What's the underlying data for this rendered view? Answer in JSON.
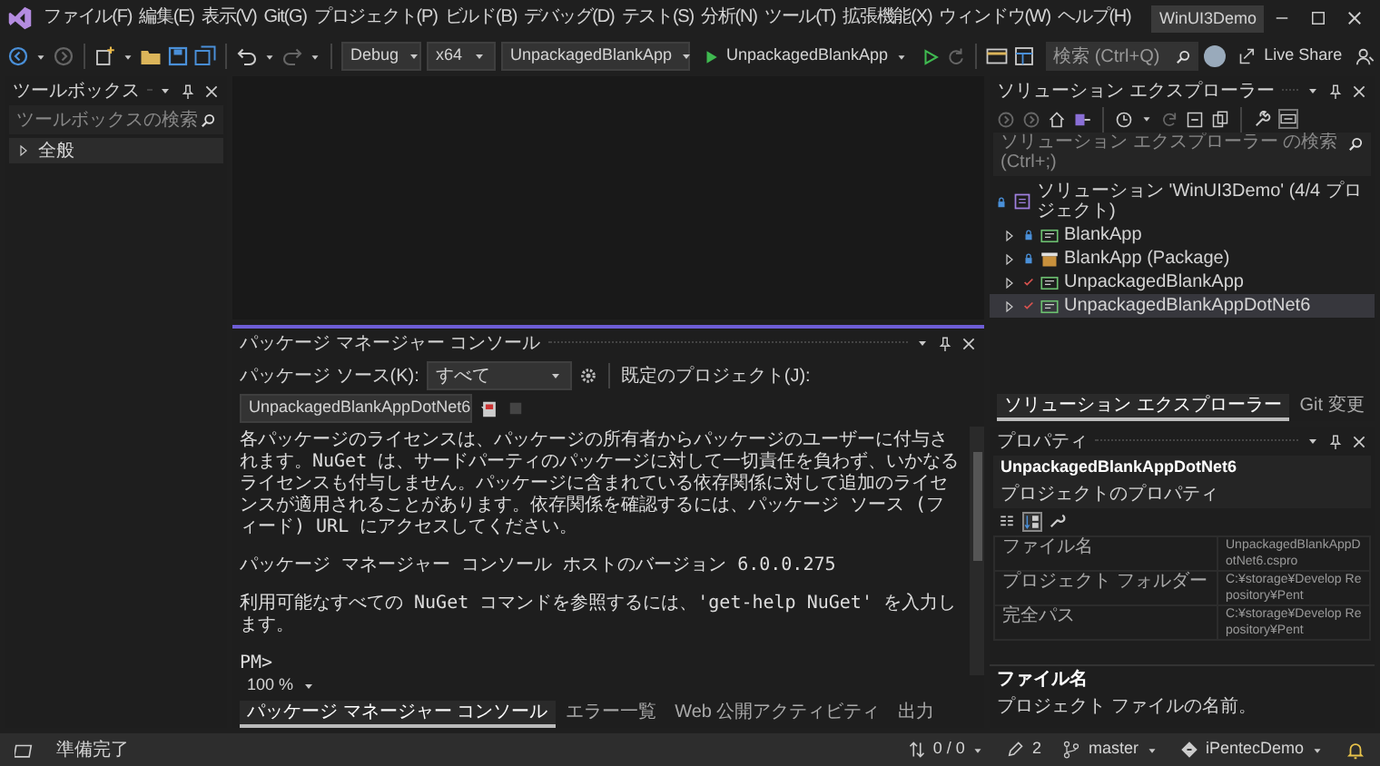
{
  "title_bar": {
    "menu": [
      "ファイル(F)",
      "編集(E)",
      "表示(V)",
      "Git(G)",
      "プロジェクト(P)",
      "ビルド(B)",
      "デバッグ(D)",
      "テスト(S)",
      "分析(N)",
      "ツール(T)",
      "拡張機能(X)",
      "ウィンドウ(W)",
      "ヘルプ(H)"
    ],
    "search": {
      "placeholder": "検索 (Ctrl+Q)"
    },
    "solution_name": "WinUI3Demo"
  },
  "toolbar": {
    "configuration": "Debug",
    "platform": "x64",
    "startup_project": "UnpackagedBlankApp",
    "run_label": "UnpackagedBlankApp",
    "live_share": "Live Share"
  },
  "toolbox": {
    "title": "ツールボックス",
    "search": {
      "placeholder": "ツールボックスの検索"
    },
    "items": [
      {
        "label": "全般",
        "expanded": false
      }
    ]
  },
  "console": {
    "title": "パッケージ マネージャー コンソール",
    "source_label": "パッケージ ソース(K):",
    "source": "すべて",
    "project_label": "既定のプロジェクト(J):",
    "project": "UnpackagedBlankAppDotNet6",
    "lines": [
      "各パッケージのライセンスは、パッケージの所有者からパッケージのユーザーに付与されます。NuGet は、サードパーティのパッケージに対して一切責任を負わず、いかなるライセンスも付与しません。パッケージに含まれている依存関係に対して追加のライセンスが適用されることがあります。依存関係を確認するには、パッケージ ソース (フィード) URL にアクセスしてください。",
      "パッケージ マネージャー コンソール ホストのバージョン 6.0.0.275",
      "利用可能なすべての NuGet コマンドを参照するには、'get-help NuGet' を入力します。",
      "PM>"
    ],
    "zoom": "100 %",
    "tabs": [
      {
        "label": "パッケージ マネージャー コンソール",
        "selected": true
      },
      {
        "label": "エラー一覧",
        "selected": false
      },
      {
        "label": "Web 公開アクティビティ",
        "selected": false
      },
      {
        "label": "出力",
        "selected": false
      }
    ]
  },
  "solution_explorer": {
    "title": "ソリューション エクスプローラー",
    "search": {
      "placeholder": "ソリューション エクスプローラー の検索 (Ctrl+;)"
    },
    "tree": [
      {
        "label": "ソリューション 'WinUI3Demo' (4/4 プロジェクト)",
        "kind": "solution",
        "checked_out": false,
        "selected": false,
        "children": [
          {
            "label": "BlankApp",
            "kind": "app",
            "checked_out": false,
            "expanded": false,
            "selected": false
          },
          {
            "label": "BlankApp (Package)",
            "kind": "package",
            "checked_out": false,
            "expanded": false,
            "selected": false
          },
          {
            "label": "UnpackagedBlankApp",
            "kind": "app",
            "checked_out": true,
            "expanded": false,
            "selected": false
          },
          {
            "label": "UnpackagedBlankAppDotNet6",
            "kind": "app",
            "checked_out": true,
            "expanded": false,
            "selected": true
          }
        ]
      }
    ],
    "tabs": [
      {
        "label": "ソリューション エクスプローラー",
        "selected": true
      },
      {
        "label": "Git 変更",
        "selected": false
      }
    ]
  },
  "properties": {
    "title": "プロパティ",
    "object_name": "UnpackagedBlankAppDotNet6",
    "object_type": "プロジェクトのプロパティ",
    "view_buttons": [
      {
        "kind": "categorized",
        "selected": false
      },
      {
        "kind": "alphabetical",
        "selected": true
      }
    ],
    "rows": [
      {
        "name": "ファイル名",
        "value": "UnpackagedBlankAppDotNet6.cspro"
      },
      {
        "name": "プロジェクト フォルダー",
        "value": "C:¥storage¥Develop Repository¥Pent"
      },
      {
        "name": "完全パス",
        "value": "C:¥storage¥Develop Repository¥Pent"
      }
    ],
    "description": {
      "title": "ファイル名",
      "text": "プロジェクト ファイルの名前。"
    }
  },
  "status_bar": {
    "message": "準備完了",
    "sync": "0 / 0",
    "changes": "2",
    "branch": "master",
    "repository": "iPentecDemo"
  }
}
